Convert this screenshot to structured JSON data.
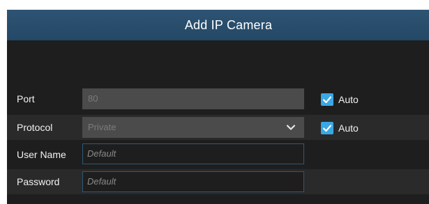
{
  "dialog": {
    "title": "Add IP Camera"
  },
  "form": {
    "port": {
      "label": "Port",
      "value": "80",
      "auto_label": "Auto",
      "auto_checked": true
    },
    "protocol": {
      "label": "Protocol",
      "value": "Private",
      "auto_label": "Auto",
      "auto_checked": true
    },
    "user_name": {
      "label": "User Name",
      "placeholder": "Default"
    },
    "password": {
      "label": "Password",
      "placeholder": "Default"
    }
  },
  "colors": {
    "title_bar": "#2a4f6e",
    "accent": "#3aa8e4",
    "background": "#1e1e1e"
  },
  "icons": {
    "dropdown": "chevron-down-icon",
    "check": "checkmark-icon"
  }
}
